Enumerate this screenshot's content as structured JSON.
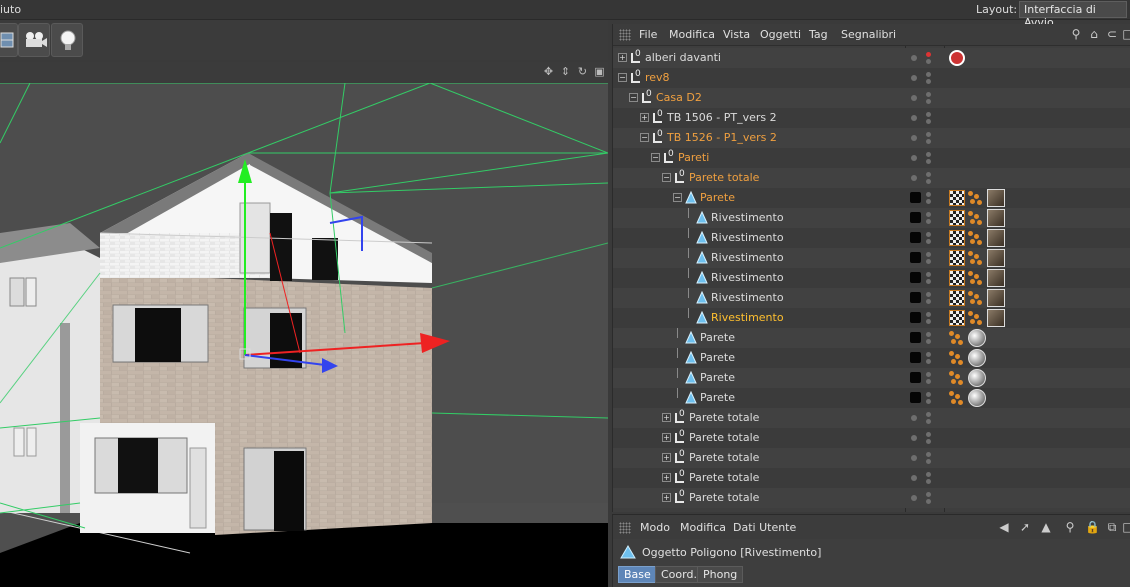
{
  "topbar": {
    "menu_help": "iuto",
    "layout_label": "Layout:",
    "layout_value": "Interfaccia di Avvio"
  },
  "object_manager": {
    "menus": [
      "File",
      "Modifica",
      "Vista",
      "Oggetti",
      "Tag",
      "Segnalibri"
    ],
    "rows": [
      {
        "label": "alberi davanti",
        "type": "null",
        "color": "norm",
        "depth": 0,
        "expand": "+",
        "tags": [
          "vray"
        ]
      },
      {
        "label": "rev8",
        "type": "null",
        "color": "orange",
        "depth": 0,
        "expand": "-",
        "tags": []
      },
      {
        "label": "Casa D2",
        "type": "null",
        "color": "orange",
        "depth": 1,
        "expand": "-",
        "tags": []
      },
      {
        "label": "TB 1506 - PT_vers 2",
        "type": "null",
        "color": "norm",
        "depth": 2,
        "expand": "+",
        "tags": []
      },
      {
        "label": "TB 1526 - P1_vers 2",
        "type": "null",
        "color": "orange",
        "depth": 2,
        "expand": "-",
        "tags": []
      },
      {
        "label": "Pareti",
        "type": "null",
        "color": "orange",
        "depth": 3,
        "expand": "-",
        "tags": []
      },
      {
        "label": "Parete totale",
        "type": "null",
        "color": "orange",
        "depth": 4,
        "expand": "-",
        "tags": []
      },
      {
        "label": "Parete",
        "type": "poly",
        "color": "orange",
        "depth": 5,
        "expand": "-",
        "tags": [
          "check",
          "dots",
          "box"
        ]
      },
      {
        "label": "Rivestimento",
        "type": "poly",
        "color": "norm",
        "depth": 6,
        "expand": "",
        "tags": [
          "check",
          "dots",
          "box"
        ]
      },
      {
        "label": "Rivestimento",
        "type": "poly",
        "color": "norm",
        "depth": 6,
        "expand": "",
        "tags": [
          "check",
          "dots",
          "box"
        ]
      },
      {
        "label": "Rivestimento",
        "type": "poly",
        "color": "norm",
        "depth": 6,
        "expand": "",
        "tags": [
          "check",
          "dots",
          "box"
        ]
      },
      {
        "label": "Rivestimento",
        "type": "poly",
        "color": "norm",
        "depth": 6,
        "expand": "",
        "tags": [
          "check",
          "dots",
          "box"
        ]
      },
      {
        "label": "Rivestimento",
        "type": "poly",
        "color": "norm",
        "depth": 6,
        "expand": "",
        "tags": [
          "check",
          "dots",
          "box"
        ]
      },
      {
        "label": "Rivestimento",
        "type": "poly",
        "color": "bright",
        "depth": 6,
        "expand": "",
        "tags": [
          "check",
          "dots",
          "box"
        ]
      },
      {
        "label": "Parete",
        "type": "poly",
        "color": "norm",
        "depth": 5,
        "expand": "",
        "tags": [
          "dots",
          "sphere"
        ]
      },
      {
        "label": "Parete",
        "type": "poly",
        "color": "norm",
        "depth": 5,
        "expand": "",
        "tags": [
          "dots",
          "sphere"
        ]
      },
      {
        "label": "Parete",
        "type": "poly",
        "color": "norm",
        "depth": 5,
        "expand": "",
        "tags": [
          "dots",
          "sphere"
        ]
      },
      {
        "label": "Parete",
        "type": "poly",
        "color": "norm",
        "depth": 5,
        "expand": "",
        "tags": [
          "dots",
          "sphere"
        ]
      },
      {
        "label": "Parete totale",
        "type": "null",
        "color": "norm",
        "depth": 4,
        "expand": "+",
        "tags": []
      },
      {
        "label": "Parete totale",
        "type": "null",
        "color": "norm",
        "depth": 4,
        "expand": "+",
        "tags": []
      },
      {
        "label": "Parete totale",
        "type": "null",
        "color": "norm",
        "depth": 4,
        "expand": "+",
        "tags": []
      },
      {
        "label": "Parete totale",
        "type": "null",
        "color": "norm",
        "depth": 4,
        "expand": "+",
        "tags": []
      },
      {
        "label": "Parete totale",
        "type": "null",
        "color": "norm",
        "depth": 4,
        "expand": "+",
        "tags": []
      }
    ]
  },
  "attribute_manager": {
    "menus": [
      "Modo",
      "Modifica",
      "Dati Utente"
    ],
    "title": "Oggetto Poligono [Rivestimento]",
    "tabs": [
      "Base",
      "Coord.",
      "Phong"
    ]
  },
  "colors": {
    "orange": "#f0a040",
    "highlight": "#ffc030",
    "accent": "#5e86b8"
  }
}
